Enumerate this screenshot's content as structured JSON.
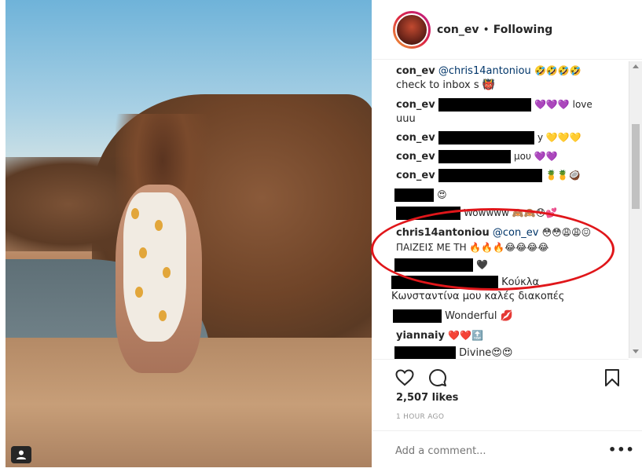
{
  "header": {
    "username": "con_ev",
    "separator": "•",
    "follow_status": "Following"
  },
  "comments": [
    {
      "user": "con_ev",
      "mention": "@chris14antoniou",
      "text": "🤣🤣🤣🤣",
      "line2": "check to inbox s 👹"
    },
    {
      "user": "con_ev",
      "text": "💜💜💜 love",
      "line2": "uuu"
    },
    {
      "user": "con_ev",
      "text": "y 💛💛💛"
    },
    {
      "user": "con_ev",
      "text": "μου 💜💜"
    },
    {
      "user": "con_ev",
      "text": "🍍🍍🥥"
    },
    {
      "text": "😍"
    },
    {
      "text": "Wowwww 🙈🙈😯💕"
    },
    {
      "user": "chris14antoniou",
      "mention": "@con_ev",
      "text": "😳😳😩😩😖",
      "line2": "ΠΑΙΖΕΙΣ ΜΕ ΤΗ 🔥🔥🔥😂😂😂😂"
    },
    {
      "text": "🖤"
    },
    {
      "text": "Κούκλα",
      "line2": "Κωνσταντίνα μου καλές διακοπές"
    },
    {
      "text": "Wonderful 💋"
    },
    {
      "user": "yiannaiy",
      "text": "❤️❤️🔝"
    },
    {
      "text": "Divine😍😍"
    }
  ],
  "actions": {
    "like_icon": "heart-icon",
    "comment_icon": "comment-icon",
    "save_icon": "bookmark-icon"
  },
  "likes": "2,507 likes",
  "time": "1 HOUR AGO",
  "add_comment": {
    "placeholder": "Add a comment...",
    "more": "•••"
  }
}
